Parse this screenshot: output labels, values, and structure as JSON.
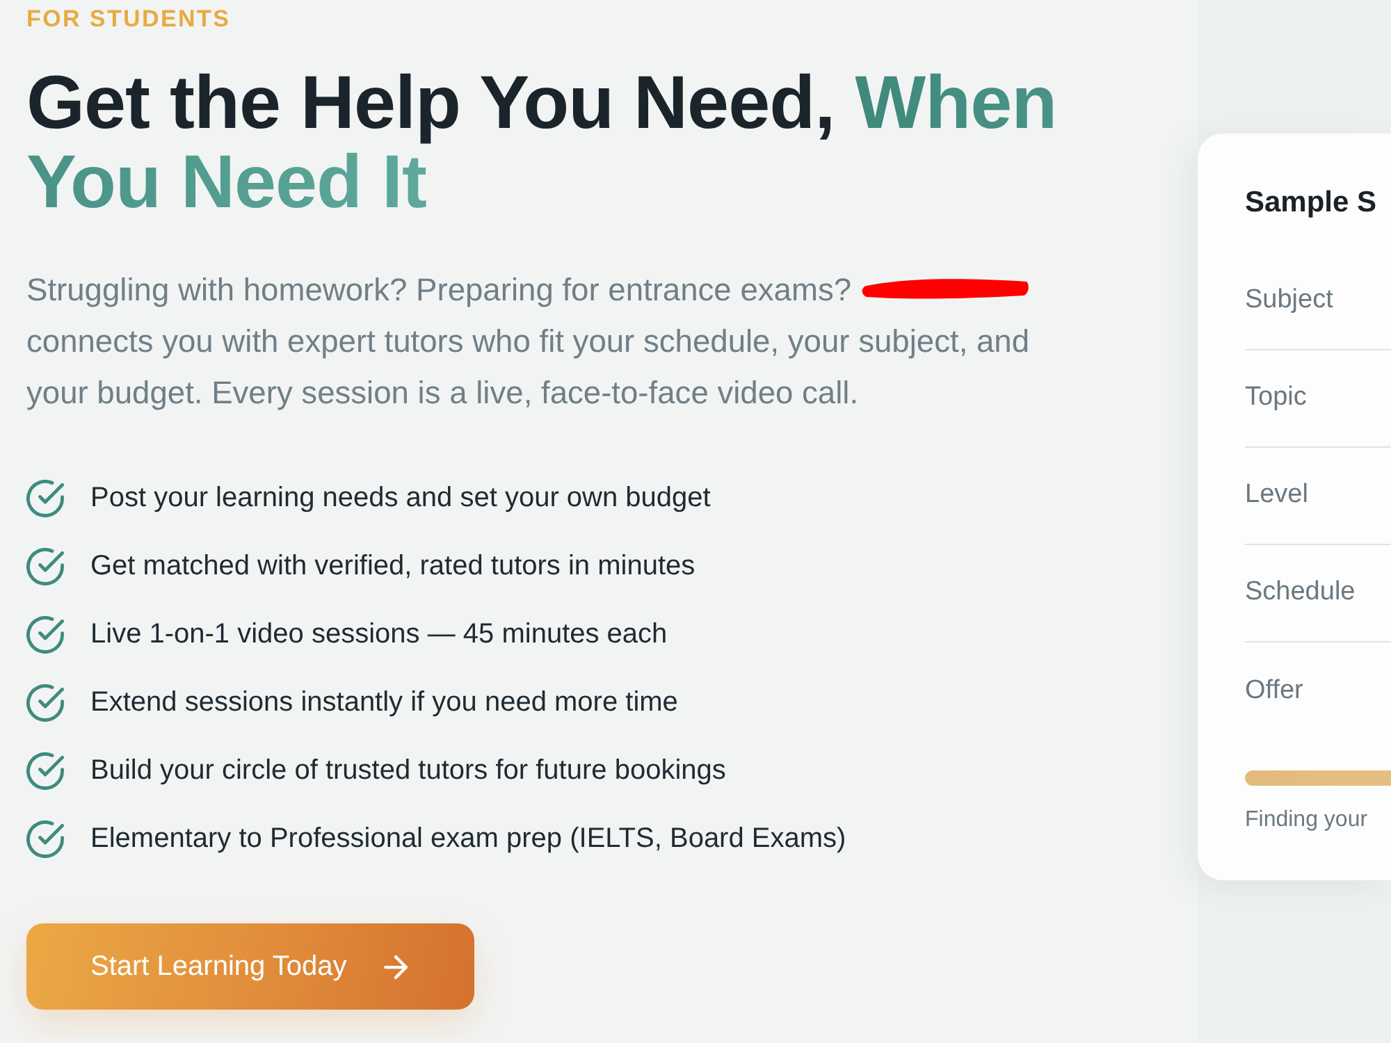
{
  "eyebrow": "FOR STUDENTS",
  "heading": {
    "text": "Get the Help You Need,",
    "highlight": "When You Need It"
  },
  "description": {
    "before": "Struggling with homework? Preparing for entrance exams?",
    "redacted": true,
    "after": "connects you with expert tutors who fit your schedule, your subject, and your budget. Every session is a live, face-to-face video call."
  },
  "features": [
    "Post your learning needs and set your own budget",
    "Get matched with verified, rated tutors in minutes",
    "Live 1-on-1 video sessions — 45 minutes each",
    "Extend sessions instantly if you need more time",
    "Build your circle of trusted tutors for future bookings",
    "Elementary to Professional exam prep (IELTS, Board Exams)"
  ],
  "cta_button": {
    "label": "Start Learning Today"
  },
  "sample_card": {
    "title": "Sample S",
    "fields": [
      {
        "label": "Subject"
      },
      {
        "label": "Topic"
      },
      {
        "label": "Level"
      },
      {
        "label": "Schedule"
      },
      {
        "label": "Offer"
      }
    ],
    "progress": {
      "level": 1
    },
    "status": "Finding your"
  }
}
